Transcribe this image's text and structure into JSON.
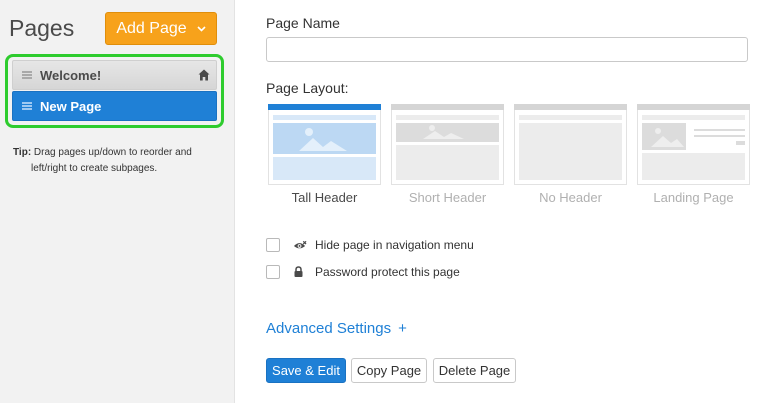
{
  "sidebar": {
    "title": "Pages",
    "add_page_label": "Add Page",
    "pages": [
      {
        "label": "Welcome!",
        "icon": "home-icon"
      },
      {
        "label": "New Page"
      }
    ],
    "tip_label": "Tip:",
    "tip_line1": " Drag pages up/down to reorder and",
    "tip_line2": "left/right to create subpages."
  },
  "form": {
    "page_name_label": "Page Name",
    "page_name_value": "",
    "page_name_placeholder": "",
    "page_layout_label": "Page Layout:",
    "layouts": [
      {
        "label": "Tall Header",
        "selected": true
      },
      {
        "label": "Short Header",
        "selected": false
      },
      {
        "label": "No Header",
        "selected": false
      },
      {
        "label": "Landing Page",
        "selected": false
      }
    ],
    "options": [
      {
        "label": "Hide page in navigation menu",
        "icon": "eye-hidden-icon",
        "checked": false
      },
      {
        "label": "Password protect this page",
        "icon": "lock-icon",
        "checked": false
      }
    ],
    "advanced_settings_label": "Advanced Settings",
    "advanced_settings_icon": "+",
    "buttons": {
      "save_edit": "Save & Edit",
      "copy": "Copy Page",
      "delete": "Delete Page"
    }
  },
  "colors": {
    "accent_blue": "#1f80d6",
    "add_button_orange": "#f7a21b",
    "highlight_green": "#2ecc2e",
    "sidebar_bg": "#f2f2f2"
  }
}
